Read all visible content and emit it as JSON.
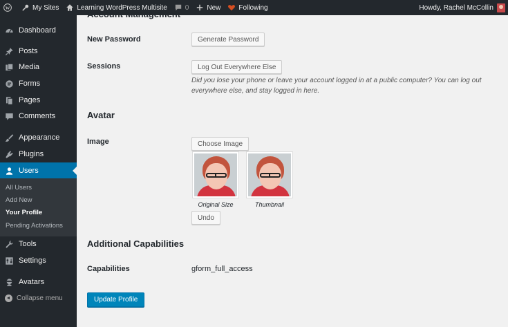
{
  "adminbar": {
    "my_sites": "My Sites",
    "site_name": "Learning WordPress Multisite",
    "comments_count": "0",
    "new_label": "New",
    "following_label": "Following",
    "howdy": "Howdy, Rachel McCollin"
  },
  "sidebar": {
    "items": [
      {
        "label": "Dashboard",
        "icon": "dashboard-icon"
      },
      {
        "label": "Posts",
        "icon": "pushpin-icon"
      },
      {
        "label": "Media",
        "icon": "media-icon"
      },
      {
        "label": "Forms",
        "icon": "forms-icon"
      },
      {
        "label": "Pages",
        "icon": "pages-icon"
      },
      {
        "label": "Comments",
        "icon": "comment-icon"
      },
      {
        "label": "Appearance",
        "icon": "paintbrush-icon"
      },
      {
        "label": "Plugins",
        "icon": "plugin-icon"
      },
      {
        "label": "Users",
        "icon": "user-icon"
      },
      {
        "label": "Tools",
        "icon": "wrench-icon"
      },
      {
        "label": "Settings",
        "icon": "settings-icon"
      },
      {
        "label": "Avatars",
        "icon": "avatar-ninja-icon"
      }
    ],
    "submenu": [
      "All Users",
      "Add New",
      "Your Profile",
      "Pending Activations"
    ],
    "collapse": "Collapse menu"
  },
  "content": {
    "top_heading_partial": "Account Management",
    "new_password_label": "New Password",
    "generate_password_btn": "Generate Password",
    "sessions_label": "Sessions",
    "logout_everywhere_btn": "Log Out Everywhere Else",
    "sessions_desc": "Did you lose your phone or leave your account logged in at a public computer? You can log out everywhere else, and stay logged in here.",
    "avatar_heading": "Avatar",
    "image_label": "Image",
    "choose_image_btn": "Choose Image",
    "original_caption": "Original Size",
    "thumbnail_caption": "Thumbnail",
    "undo_btn": "Undo",
    "additional_heading": "Additional Capabilities",
    "capabilities_label": "Capabilities",
    "capabilities_value": "gform_full_access",
    "update_btn": "Update Profile"
  },
  "colors": {
    "adminbar_bg": "#23282d",
    "accent": "#0073aa",
    "primary_button": "#0085ba",
    "heart": "#d54e21"
  }
}
